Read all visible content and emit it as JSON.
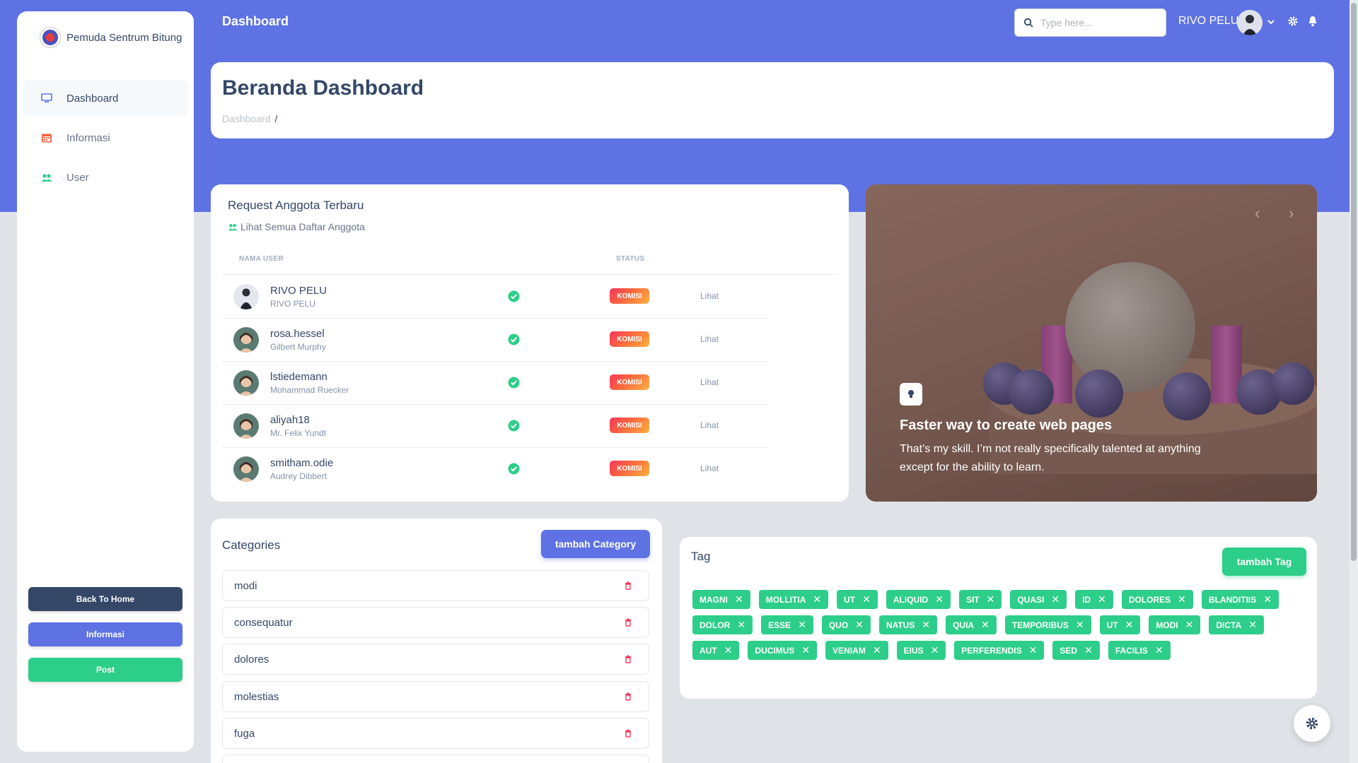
{
  "brand": {
    "name": "Pemuda Sentrum Bitung"
  },
  "sidebar": {
    "items": [
      {
        "label": "Dashboard",
        "icon": "monitor-icon",
        "active": true
      },
      {
        "label": "Informasi",
        "icon": "calendar-icon",
        "active": false
      },
      {
        "label": "User",
        "icon": "users-icon",
        "active": false
      }
    ],
    "buttons": [
      {
        "label": "Back To Home",
        "color": "#344767"
      },
      {
        "label": "Informasi",
        "color": "#5e72e4"
      },
      {
        "label": "Post",
        "color": "#2dce89"
      }
    ]
  },
  "navbar": {
    "title": "Dashboard",
    "search_placeholder": "Type here...",
    "user_name": "RIVO PELU"
  },
  "header": {
    "title": "Beranda Dashboard",
    "breadcrumb": "Dashboard",
    "breadcrumb_sep": "/"
  },
  "requests": {
    "title": "Request Anggota Terbaru",
    "subtitle": "Lihat Semua Daftar Anggota",
    "columns": {
      "user": "NAMA USER",
      "status": "STATUS"
    },
    "rows": [
      {
        "name": "RIVO PELU",
        "sub": "RIVO PELU",
        "badge": "KOMISI",
        "action": "Lihat"
      },
      {
        "name": "rosa.hessel",
        "sub": "Gilbert Murphy",
        "badge": "KOMISI",
        "action": "Lihat"
      },
      {
        "name": "lstiedemann",
        "sub": "Mohammad Ruecker",
        "badge": "KOMISI",
        "action": "Lihat"
      },
      {
        "name": "aliyah18",
        "sub": "Mr. Felix Yundt",
        "badge": "KOMISI",
        "action": "Lihat"
      },
      {
        "name": "smitham.odie",
        "sub": "Audrey Dibbert",
        "badge": "KOMISI",
        "action": "Lihat"
      }
    ]
  },
  "carousel": {
    "title": "Faster way to create web pages",
    "text": "That’s my skill. I’m not really specifically talented at anything except for the ability to learn.",
    "prev": "‹",
    "next": "›"
  },
  "categories": {
    "title": "Categories",
    "add_label": "tambah Category",
    "items": [
      "modi",
      "consequatur",
      "dolores",
      "molestias",
      "fuga"
    ]
  },
  "tags": {
    "title": "Tag",
    "add_label": "tambah Tag",
    "items": [
      "MAGNI",
      "MOLLITIA",
      "UT",
      "ALIQUID",
      "SIT",
      "QUASI",
      "ID",
      "DOLORES",
      "BLANDITIIS",
      "DOLOR",
      "ESSE",
      "QUO",
      "NATUS",
      "QUIA",
      "TEMPORIBUS",
      "UT",
      "MODI",
      "DICTA",
      "AUT",
      "DUCIMUS",
      "VENIAM",
      "EIUS",
      "PERFERENDIS",
      "SED",
      "FACILIS"
    ]
  },
  "colors": {
    "primary": "#5e72e4",
    "success": "#2dce89",
    "dark": "#344767",
    "badge_orange": "#fb6340"
  }
}
